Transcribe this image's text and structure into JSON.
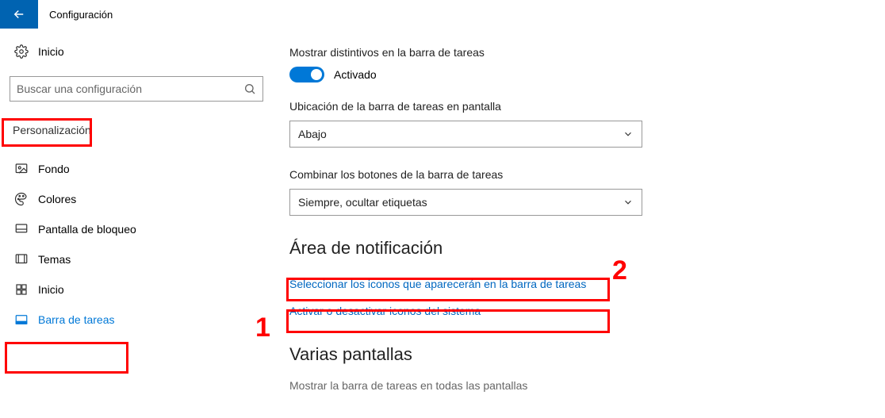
{
  "header": {
    "title": "Configuración"
  },
  "sidebar": {
    "home": "Inicio",
    "search_placeholder": "Buscar una configuración",
    "category": "Personalización",
    "items": [
      {
        "label": "Fondo"
      },
      {
        "label": "Colores"
      },
      {
        "label": "Pantalla de bloqueo"
      },
      {
        "label": "Temas"
      },
      {
        "label": "Inicio"
      },
      {
        "label": "Barra de tareas"
      }
    ]
  },
  "content": {
    "badges_label": "Mostrar distintivos en la barra de tareas",
    "toggle_state": "Activado",
    "location_label": "Ubicación de la barra de tareas en pantalla",
    "location_value": "Abajo",
    "combine_label": "Combinar los botones de la barra de tareas",
    "combine_value": "Siempre, ocultar etiquetas",
    "notification_title": "Área de notificación",
    "link_select_icons": "Seleccionar los iconos que aparecerán en la barra de tareas",
    "link_system_icons": "Activar o desactivar iconos del sistema",
    "multi_title": "Varias pantallas",
    "multi_sub": "Mostrar la barra de tareas en todas las pantallas"
  },
  "annotations": {
    "n1": "1",
    "n2": "2"
  }
}
